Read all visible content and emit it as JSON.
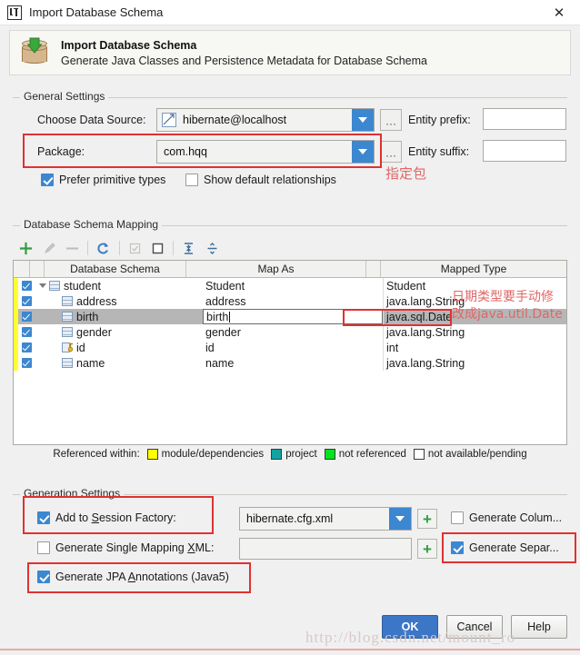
{
  "window": {
    "title": "Import Database Schema",
    "icon": "intellij-idea-icon",
    "close_label": "✕"
  },
  "banner": {
    "icon": "database-import-icon",
    "title": "Import Database Schema",
    "subtitle": "Generate Java Classes and Persistence Metadata for Database Schema"
  },
  "general_settings": {
    "group_label": "General Settings",
    "data_source_label": "Choose Data Source:",
    "data_source_value": "hibernate@localhost",
    "data_source_icon": "datasource-icon",
    "data_source_browse": "···",
    "entity_prefix_label": "Entity prefix:",
    "entity_prefix_value": "",
    "package_label": "Package:",
    "package_value": "com.hqq",
    "package_browse": "···",
    "entity_suffix_label": "Entity suffix:",
    "entity_suffix_value": "",
    "prefer_primitive_label": "Prefer primitive types",
    "prefer_primitive_checked": true,
    "show_default_rel_label": "Show default relationships",
    "show_default_rel_checked": false
  },
  "schema_mapping": {
    "group_label": "Database Schema Mapping",
    "toolbar": [
      {
        "name": "add-icon",
        "glyph": "+",
        "color": "#2f9e3f",
        "enabled": true
      },
      {
        "name": "edit-pencil-icon",
        "glyph": "✎",
        "color": "#b8b8b3",
        "enabled": false
      },
      {
        "name": "remove-icon",
        "glyph": "−",
        "color": "#b8b8b3",
        "enabled": false
      },
      {
        "name": "refresh-icon",
        "glyph": "↺",
        "color": "#3c7ec4",
        "enabled": true
      },
      {
        "name": "select-all-checkbox-icon",
        "glyph": "☑",
        "color": "#c3c3be",
        "enabled": false
      },
      {
        "name": "deselect-all-icon",
        "glyph": "□",
        "color": "#4a4a46",
        "enabled": true
      },
      {
        "name": "expand-all-icon",
        "glyph": "⧉",
        "color": "#3c6f9e",
        "enabled": true
      },
      {
        "name": "collapse-all-icon",
        "glyph": "⤓",
        "color": "#3c6f9e",
        "enabled": true
      }
    ],
    "columns": [
      "Database Schema",
      "Map As",
      "Mapped Type"
    ],
    "rows": [
      {
        "checked": true,
        "marker": "#ffff33",
        "level": 0,
        "expander": true,
        "icon": "table-icon",
        "schema": "student",
        "map_as": "Student",
        "mapped_type": "Student",
        "selected": false,
        "editing": false
      },
      {
        "checked": true,
        "marker": "#ffff33",
        "level": 1,
        "expander": false,
        "icon": "column-icon",
        "schema": "address",
        "map_as": "address",
        "mapped_type": "java.lang.String",
        "selected": false,
        "editing": false
      },
      {
        "checked": true,
        "marker": "#ffff33",
        "level": 1,
        "expander": false,
        "icon": "column-icon",
        "schema": "birth",
        "map_as": "birth",
        "mapped_type": "java.sql.Date",
        "selected": true,
        "editing": true
      },
      {
        "checked": true,
        "marker": "#ffff33",
        "level": 1,
        "expander": false,
        "icon": "column-icon",
        "schema": "gender",
        "map_as": "gender",
        "mapped_type": "java.lang.String",
        "selected": false,
        "editing": false
      },
      {
        "checked": true,
        "marker": "#ffff33",
        "level": 1,
        "expander": false,
        "icon": "primary-key-icon",
        "schema": "id",
        "map_as": "id",
        "mapped_type": "int",
        "selected": false,
        "editing": false
      },
      {
        "checked": true,
        "marker": "#ffff33",
        "level": 1,
        "expander": false,
        "icon": "column-icon",
        "schema": "name",
        "map_as": "name",
        "mapped_type": "java.lang.String",
        "selected": false,
        "editing": false
      }
    ],
    "legend_label": "Referenced within:",
    "legend_items": [
      {
        "label": "module/dependencies",
        "color": "#ffff00"
      },
      {
        "label": "project",
        "color": "#13a3a3"
      },
      {
        "label": "not referenced",
        "color": "#00e51e"
      },
      {
        "label": "not available/pending",
        "color": "#ffffff"
      }
    ]
  },
  "generation_settings": {
    "group_label": "Generation Settings",
    "add_session_factory_label": "Add to Session Factory:",
    "add_session_factory_checked": true,
    "session_factory_value": "hibernate.cfg.xml",
    "single_mapping_label": "Generate Single Mapping XML:",
    "single_mapping_checked": false,
    "single_mapping_value": "",
    "jpa_annotations_label": "Generate JPA Annotations (Java5)",
    "jpa_annotations_checked": true,
    "generate_column_label": "Generate Colum...",
    "generate_column_checked": false,
    "generate_separate_label": "Generate Separ...",
    "generate_separate_checked": true,
    "add_plus_label": "+",
    "single_plus_label": "+"
  },
  "footer": {
    "ok_label": "OK",
    "cancel_label": "Cancel",
    "help_label": "Help",
    "watermark": "http://blog.csdn.net/mount_ro"
  },
  "annotations": {
    "package_note": "指定包",
    "mapped_type_note_line1": "日期类型要手动修",
    "mapped_type_note_line2": "改成java.util.Date"
  }
}
